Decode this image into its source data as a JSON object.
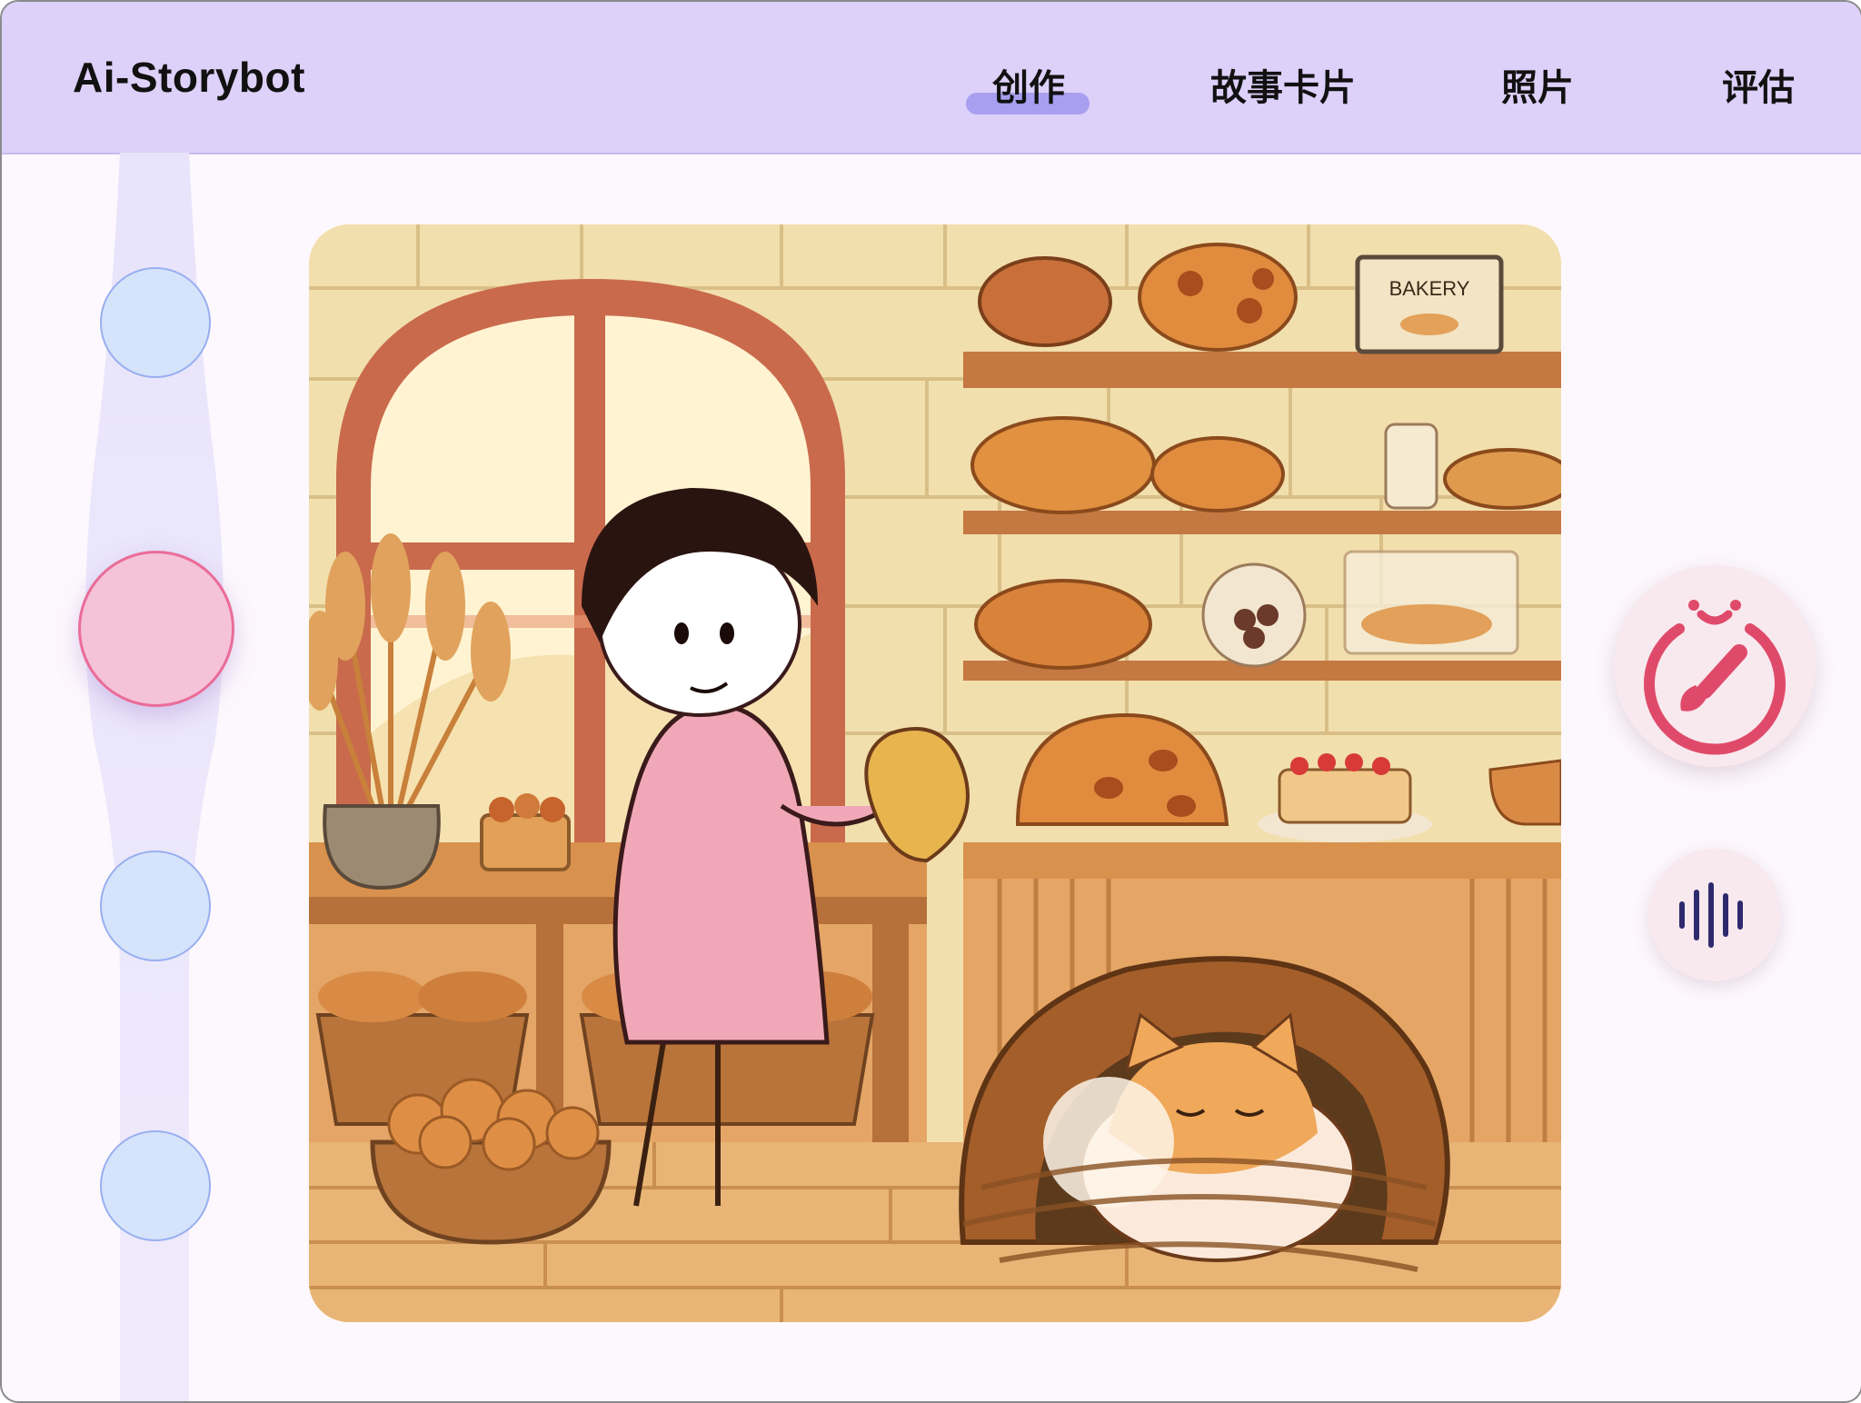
{
  "app": {
    "title": "Ai-Storybot"
  },
  "nav": {
    "tabs": [
      {
        "label": "创作",
        "active": true
      },
      {
        "label": "故事卡片",
        "active": false
      },
      {
        "label": "照片",
        "active": false
      },
      {
        "label": "评估",
        "active": false
      }
    ]
  },
  "progress": {
    "steps": 4,
    "current_step": 2
  },
  "scene": {
    "sign_text": "BAKERY"
  },
  "actions": {
    "draw_icon": "brush-timer-icon",
    "voice_icon": "voice-wave-icon"
  },
  "colors": {
    "header_bg": "#ddd0f9",
    "active_indicator": "#a89ff0",
    "step_node": "#d6e4fb",
    "current_step_node": "#f4c3d8",
    "accent_red": "#e04a6a",
    "voice_icon": "#2f2a6e"
  }
}
